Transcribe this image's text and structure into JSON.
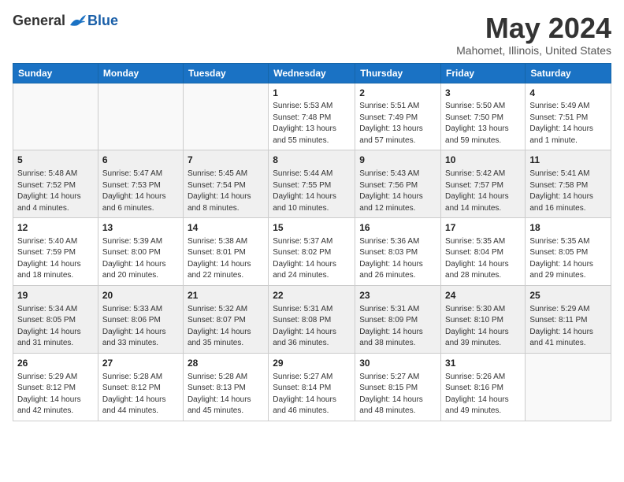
{
  "logo": {
    "general": "General",
    "blue": "Blue"
  },
  "title": "May 2024",
  "location": "Mahomet, Illinois, United States",
  "days_of_week": [
    "Sunday",
    "Monday",
    "Tuesday",
    "Wednesday",
    "Thursday",
    "Friday",
    "Saturday"
  ],
  "weeks": [
    [
      {
        "day": "",
        "info": ""
      },
      {
        "day": "",
        "info": ""
      },
      {
        "day": "",
        "info": ""
      },
      {
        "day": "1",
        "info": "Sunrise: 5:53 AM\nSunset: 7:48 PM\nDaylight: 13 hours\nand 55 minutes."
      },
      {
        "day": "2",
        "info": "Sunrise: 5:51 AM\nSunset: 7:49 PM\nDaylight: 13 hours\nand 57 minutes."
      },
      {
        "day": "3",
        "info": "Sunrise: 5:50 AM\nSunset: 7:50 PM\nDaylight: 13 hours\nand 59 minutes."
      },
      {
        "day": "4",
        "info": "Sunrise: 5:49 AM\nSunset: 7:51 PM\nDaylight: 14 hours\nand 1 minute."
      }
    ],
    [
      {
        "day": "5",
        "info": "Sunrise: 5:48 AM\nSunset: 7:52 PM\nDaylight: 14 hours\nand 4 minutes."
      },
      {
        "day": "6",
        "info": "Sunrise: 5:47 AM\nSunset: 7:53 PM\nDaylight: 14 hours\nand 6 minutes."
      },
      {
        "day": "7",
        "info": "Sunrise: 5:45 AM\nSunset: 7:54 PM\nDaylight: 14 hours\nand 8 minutes."
      },
      {
        "day": "8",
        "info": "Sunrise: 5:44 AM\nSunset: 7:55 PM\nDaylight: 14 hours\nand 10 minutes."
      },
      {
        "day": "9",
        "info": "Sunrise: 5:43 AM\nSunset: 7:56 PM\nDaylight: 14 hours\nand 12 minutes."
      },
      {
        "day": "10",
        "info": "Sunrise: 5:42 AM\nSunset: 7:57 PM\nDaylight: 14 hours\nand 14 minutes."
      },
      {
        "day": "11",
        "info": "Sunrise: 5:41 AM\nSunset: 7:58 PM\nDaylight: 14 hours\nand 16 minutes."
      }
    ],
    [
      {
        "day": "12",
        "info": "Sunrise: 5:40 AM\nSunset: 7:59 PM\nDaylight: 14 hours\nand 18 minutes."
      },
      {
        "day": "13",
        "info": "Sunrise: 5:39 AM\nSunset: 8:00 PM\nDaylight: 14 hours\nand 20 minutes."
      },
      {
        "day": "14",
        "info": "Sunrise: 5:38 AM\nSunset: 8:01 PM\nDaylight: 14 hours\nand 22 minutes."
      },
      {
        "day": "15",
        "info": "Sunrise: 5:37 AM\nSunset: 8:02 PM\nDaylight: 14 hours\nand 24 minutes."
      },
      {
        "day": "16",
        "info": "Sunrise: 5:36 AM\nSunset: 8:03 PM\nDaylight: 14 hours\nand 26 minutes."
      },
      {
        "day": "17",
        "info": "Sunrise: 5:35 AM\nSunset: 8:04 PM\nDaylight: 14 hours\nand 28 minutes."
      },
      {
        "day": "18",
        "info": "Sunrise: 5:35 AM\nSunset: 8:05 PM\nDaylight: 14 hours\nand 29 minutes."
      }
    ],
    [
      {
        "day": "19",
        "info": "Sunrise: 5:34 AM\nSunset: 8:05 PM\nDaylight: 14 hours\nand 31 minutes."
      },
      {
        "day": "20",
        "info": "Sunrise: 5:33 AM\nSunset: 8:06 PM\nDaylight: 14 hours\nand 33 minutes."
      },
      {
        "day": "21",
        "info": "Sunrise: 5:32 AM\nSunset: 8:07 PM\nDaylight: 14 hours\nand 35 minutes."
      },
      {
        "day": "22",
        "info": "Sunrise: 5:31 AM\nSunset: 8:08 PM\nDaylight: 14 hours\nand 36 minutes."
      },
      {
        "day": "23",
        "info": "Sunrise: 5:31 AM\nSunset: 8:09 PM\nDaylight: 14 hours\nand 38 minutes."
      },
      {
        "day": "24",
        "info": "Sunrise: 5:30 AM\nSunset: 8:10 PM\nDaylight: 14 hours\nand 39 minutes."
      },
      {
        "day": "25",
        "info": "Sunrise: 5:29 AM\nSunset: 8:11 PM\nDaylight: 14 hours\nand 41 minutes."
      }
    ],
    [
      {
        "day": "26",
        "info": "Sunrise: 5:29 AM\nSunset: 8:12 PM\nDaylight: 14 hours\nand 42 minutes."
      },
      {
        "day": "27",
        "info": "Sunrise: 5:28 AM\nSunset: 8:12 PM\nDaylight: 14 hours\nand 44 minutes."
      },
      {
        "day": "28",
        "info": "Sunrise: 5:28 AM\nSunset: 8:13 PM\nDaylight: 14 hours\nand 45 minutes."
      },
      {
        "day": "29",
        "info": "Sunrise: 5:27 AM\nSunset: 8:14 PM\nDaylight: 14 hours\nand 46 minutes."
      },
      {
        "day": "30",
        "info": "Sunrise: 5:27 AM\nSunset: 8:15 PM\nDaylight: 14 hours\nand 48 minutes."
      },
      {
        "day": "31",
        "info": "Sunrise: 5:26 AM\nSunset: 8:16 PM\nDaylight: 14 hours\nand 49 minutes."
      },
      {
        "day": "",
        "info": ""
      }
    ]
  ]
}
